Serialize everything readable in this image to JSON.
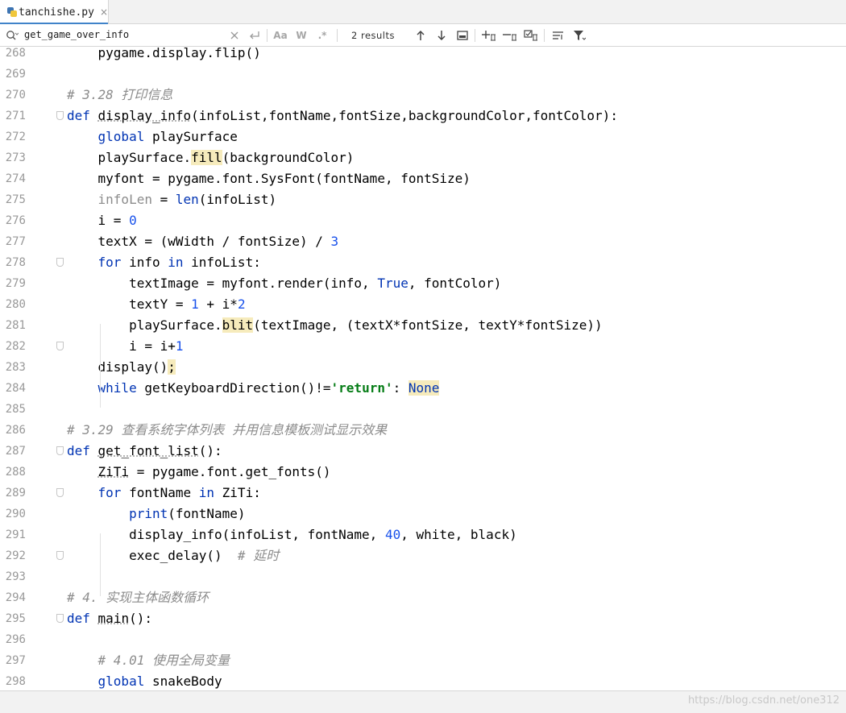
{
  "tab": {
    "filename": "tanchishe.py",
    "close": "×"
  },
  "search": {
    "query": "get_game_over_info",
    "results": "2 results",
    "match_case": "Aa",
    "words": "W",
    "regex": ".*",
    "icons": [
      "search-icon",
      "clear-icon",
      "newline-icon",
      "match-case",
      "words",
      "regex",
      "prev-arrow-icon",
      "next-arrow-icon",
      "select-all-icon",
      "add-selection-icon",
      "remove-selection-icon",
      "select-all-occurrences-icon",
      "filter-settings-icon",
      "filter-icon"
    ]
  },
  "editor": {
    "line_numbers": [
      "268",
      "269",
      "270",
      "271",
      "272",
      "273",
      "274",
      "275",
      "276",
      "277",
      "278",
      "279",
      "280",
      "281",
      "282",
      "283",
      "284",
      "285",
      "286",
      "287",
      "288",
      "289",
      "290",
      "291",
      "292",
      "293",
      "294",
      "295",
      "296",
      "297",
      "298"
    ],
    "lines": [
      [
        {
          "t": "    "
        },
        {
          "t": "pygame.display.flip()"
        }
      ],
      [],
      [
        {
          "t": "# 3.28 打印信息",
          "c": "cm"
        }
      ],
      [
        {
          "t": "def",
          "c": "kw"
        },
        {
          "t": " "
        },
        {
          "t": "display_info",
          "c": "uw"
        },
        {
          "t": "(infoList,fontName,fontSize,backgroundColor,fontColor):"
        }
      ],
      [
        {
          "t": "    "
        },
        {
          "t": "global",
          "c": "kw"
        },
        {
          "t": " playSurface"
        }
      ],
      [
        {
          "t": "    playSurface."
        },
        {
          "t": "fill",
          "c": "hl"
        },
        {
          "t": "(backgroundColor)"
        }
      ],
      [
        {
          "t": "    myfont = pygame.font.SysFont(fontName, fontSize)"
        }
      ],
      [
        {
          "t": "    "
        },
        {
          "t": "infoLen",
          "c": "unused"
        },
        {
          "t": " = "
        },
        {
          "t": "len",
          "c": "kw"
        },
        {
          "t": "(infoList)"
        }
      ],
      [
        {
          "t": "    i = "
        },
        {
          "t": "0",
          "c": "num"
        }
      ],
      [
        {
          "t": "    textX = (wWidth / fontSize) / "
        },
        {
          "t": "3",
          "c": "num"
        }
      ],
      [
        {
          "t": "    "
        },
        {
          "t": "for",
          "c": "kw"
        },
        {
          "t": " info "
        },
        {
          "t": "in",
          "c": "kw"
        },
        {
          "t": " infoList:"
        }
      ],
      [
        {
          "t": "        textImage = myfont.render(info, "
        },
        {
          "t": "True",
          "c": "kw"
        },
        {
          "t": ", fontColor)"
        }
      ],
      [
        {
          "t": "        textY = "
        },
        {
          "t": "1",
          "c": "num"
        },
        {
          "t": " + i*"
        },
        {
          "t": "2",
          "c": "num"
        }
      ],
      [
        {
          "t": "        playSurface."
        },
        {
          "t": "blit",
          "c": "hl"
        },
        {
          "t": "(textImage, (textX*fontSize, textY*fontSize))"
        }
      ],
      [
        {
          "t": "        i = i+"
        },
        {
          "t": "1",
          "c": "num"
        }
      ],
      [
        {
          "t": "    display()"
        },
        {
          "t": ";",
          "c": "hl"
        }
      ],
      [
        {
          "t": "    "
        },
        {
          "t": "while",
          "c": "kw"
        },
        {
          "t": " getKeyboardDirection()!="
        },
        {
          "t": "'return'",
          "c": "str"
        },
        {
          "t": ": "
        },
        {
          "t": "None",
          "c": "kw hl"
        }
      ],
      [],
      [
        {
          "t": "# 3.29 查看系统字体列表 并用信息模板测试显示效果",
          "c": "cm"
        }
      ],
      [
        {
          "t": "def",
          "c": "kw"
        },
        {
          "t": " "
        },
        {
          "t": "get_font_list",
          "c": "uw"
        },
        {
          "t": "():"
        }
      ],
      [
        {
          "t": "    "
        },
        {
          "t": "ZiTi",
          "c": "uw"
        },
        {
          "t": " = pygame.font.get_fonts()"
        }
      ],
      [
        {
          "t": "    "
        },
        {
          "t": "for",
          "c": "kw"
        },
        {
          "t": " fontName "
        },
        {
          "t": "in",
          "c": "kw"
        },
        {
          "t": " ZiTi:"
        }
      ],
      [
        {
          "t": "        "
        },
        {
          "t": "print",
          "c": "kw"
        },
        {
          "t": "(fontName)"
        }
      ],
      [
        {
          "t": "        display_info(infoList, fontName, "
        },
        {
          "t": "40",
          "c": "num"
        },
        {
          "t": ", white, black)"
        }
      ],
      [
        {
          "t": "        exec_delay()  "
        },
        {
          "t": "# 延时",
          "c": "cm"
        }
      ],
      [],
      [
        {
          "t": "# 4. 实现主体函数循环",
          "c": "cm"
        }
      ],
      [
        {
          "t": "def",
          "c": "kw"
        },
        {
          "t": " "
        },
        {
          "t": "main",
          "c": "uw"
        },
        {
          "t": "():"
        }
      ],
      [],
      [
        {
          "t": "    "
        },
        {
          "t": "# 4.01 使用全局变量",
          "c": "cm"
        }
      ],
      [
        {
          "t": "    "
        },
        {
          "t": "global",
          "c": "kw"
        },
        {
          "t": " snakeBody"
        }
      ]
    ]
  },
  "watermark": "https://blog.csdn.net/one312"
}
